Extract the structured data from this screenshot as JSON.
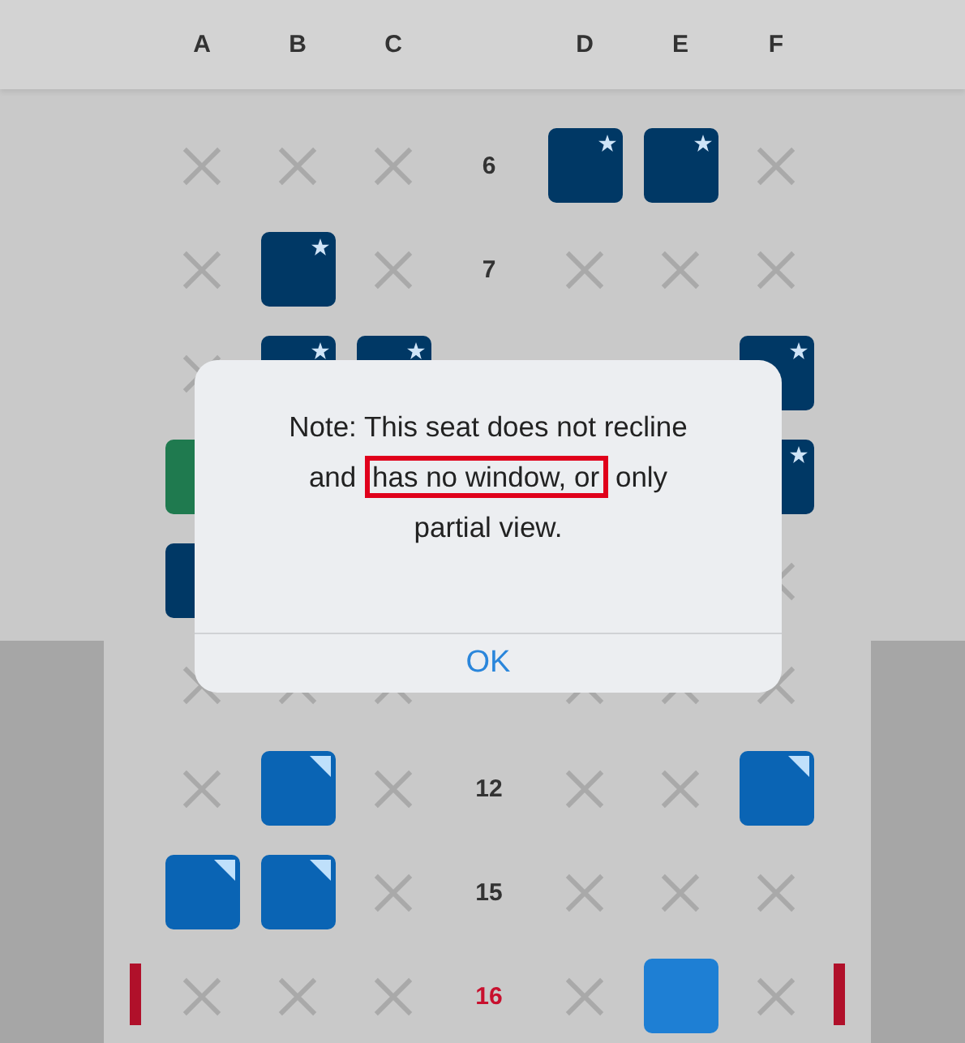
{
  "columns": [
    "A",
    "B",
    "C",
    "D",
    "E",
    "F"
  ],
  "rows": [
    {
      "number": "6",
      "exit": false,
      "seats": [
        {
          "kind": "blocked"
        },
        {
          "kind": "blocked"
        },
        {
          "kind": "blocked"
        },
        {
          "kind": "premium"
        },
        {
          "kind": "premium"
        },
        {
          "kind": "blocked"
        }
      ]
    },
    {
      "number": "7",
      "exit": false,
      "seats": [
        {
          "kind": "blocked"
        },
        {
          "kind": "premium"
        },
        {
          "kind": "blocked"
        },
        {
          "kind": "blocked"
        },
        {
          "kind": "blocked"
        },
        {
          "kind": "blocked"
        }
      ]
    },
    {
      "exit": false,
      "seats": [
        {
          "kind": "blocked"
        },
        {
          "kind": "premium"
        },
        {
          "kind": "premium"
        },
        {
          "kind": "unseen"
        },
        {
          "kind": "unseen"
        },
        {
          "kind": "premium"
        }
      ]
    },
    {
      "exit": false,
      "seats": [
        {
          "kind": "green"
        },
        {
          "kind": "unseen"
        },
        {
          "kind": "unseen"
        },
        {
          "kind": "unseen"
        },
        {
          "kind": "unseen"
        },
        {
          "kind": "premium"
        }
      ]
    },
    {
      "exit": false,
      "seats": [
        {
          "kind": "dark"
        },
        {
          "kind": "unseen"
        },
        {
          "kind": "unseen"
        },
        {
          "kind": "unseen"
        },
        {
          "kind": "unseen"
        },
        {
          "kind": "blocked"
        }
      ]
    },
    {
      "exit": false,
      "seats": [
        {
          "kind": "blocked"
        },
        {
          "kind": "blocked"
        },
        {
          "kind": "blocked"
        },
        {
          "kind": "blocked"
        },
        {
          "kind": "blocked"
        },
        {
          "kind": "blocked"
        }
      ]
    },
    {
      "number": "12",
      "exit": false,
      "seats": [
        {
          "kind": "blocked"
        },
        {
          "kind": "preferred"
        },
        {
          "kind": "blocked"
        },
        {
          "kind": "blocked"
        },
        {
          "kind": "blocked"
        },
        {
          "kind": "preferred"
        }
      ]
    },
    {
      "number": "15",
      "exit": false,
      "seats": [
        {
          "kind": "preferred"
        },
        {
          "kind": "preferred"
        },
        {
          "kind": "blocked"
        },
        {
          "kind": "blocked"
        },
        {
          "kind": "blocked"
        },
        {
          "kind": "blocked"
        }
      ]
    },
    {
      "number": "16",
      "exit": true,
      "seats": [
        {
          "kind": "blocked"
        },
        {
          "kind": "blocked"
        },
        {
          "kind": "blocked"
        },
        {
          "kind": "blocked"
        },
        {
          "kind": "selected"
        },
        {
          "kind": "blocked"
        }
      ]
    }
  ],
  "dialog": {
    "message_parts": [
      {
        "text": "Note: This seat does not recline and ",
        "highlighted": false
      },
      {
        "text": "has no window, or",
        "highlighted": true
      },
      {
        "text": " only partial view.",
        "highlighted": false
      }
    ],
    "button": "OK"
  }
}
